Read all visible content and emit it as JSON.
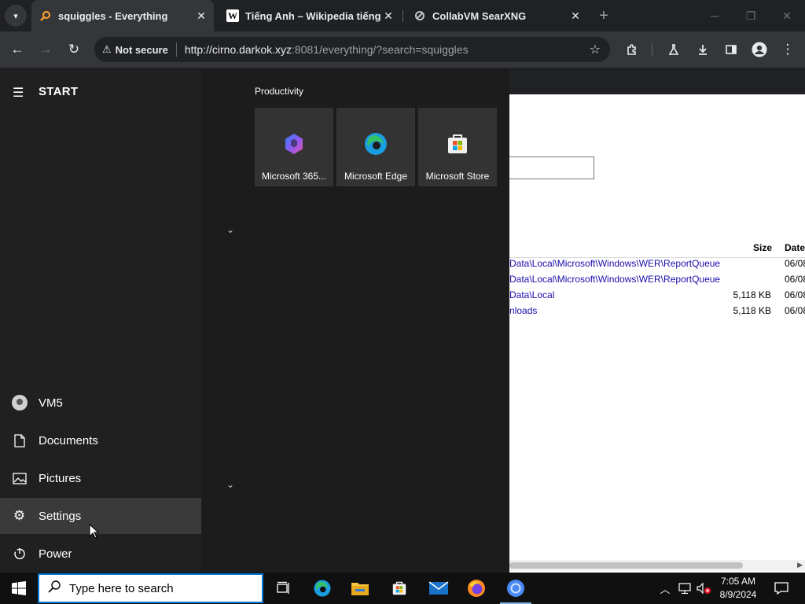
{
  "browser": {
    "tabs": [
      {
        "title": "squiggles - Everything",
        "favicon": "magnifier-favicon",
        "active": true
      },
      {
        "title": "Tiếng Anh – Wikipedia tiếng Việt",
        "favicon": "wikipedia-favicon",
        "active": false
      },
      {
        "title": "CollabVM SearXNG",
        "favicon": "searxng-favicon",
        "active": false
      }
    ],
    "security_label": "Not secure",
    "url_host": "http://cirno.darkok.xyz",
    "url_rest": ":8081/everything/?search=squiggles"
  },
  "page": {
    "columns": {
      "size": "Size",
      "date": "Date"
    },
    "rows": [
      {
        "path": "Data\\Local\\Microsoft\\Windows\\WER\\ReportQueue",
        "size": "",
        "date": "06/08"
      },
      {
        "path": "Data\\Local\\Microsoft\\Windows\\WER\\ReportQueue",
        "size": "",
        "date": "06/08"
      },
      {
        "path": "Data\\Local",
        "size": "5,118 KB",
        "date": "06/08"
      },
      {
        "path": "nloads",
        "size": "5,118 KB",
        "date": "06/08"
      }
    ]
  },
  "start_menu": {
    "title": "START",
    "user": "VM5",
    "items": [
      {
        "label": "Documents",
        "icon": "document-icon"
      },
      {
        "label": "Pictures",
        "icon": "pictures-icon"
      },
      {
        "label": "Settings",
        "icon": "gear-icon"
      },
      {
        "label": "Power",
        "icon": "power-icon"
      }
    ],
    "group_title": "Productivity",
    "tiles": [
      {
        "label": "Microsoft 365...",
        "icon": "microsoft-365-icon"
      },
      {
        "label": "Microsoft Edge",
        "icon": "edge-icon"
      },
      {
        "label": "Microsoft Store",
        "icon": "store-icon"
      }
    ]
  },
  "taskbar": {
    "search_placeholder": "Type here to search",
    "time": "7:05 AM",
    "date": "8/9/2024"
  },
  "colors": {
    "accent": "#0078d7",
    "link": "#1a0dab",
    "start_left": "#202020",
    "start_right": "#1c1c1c"
  }
}
